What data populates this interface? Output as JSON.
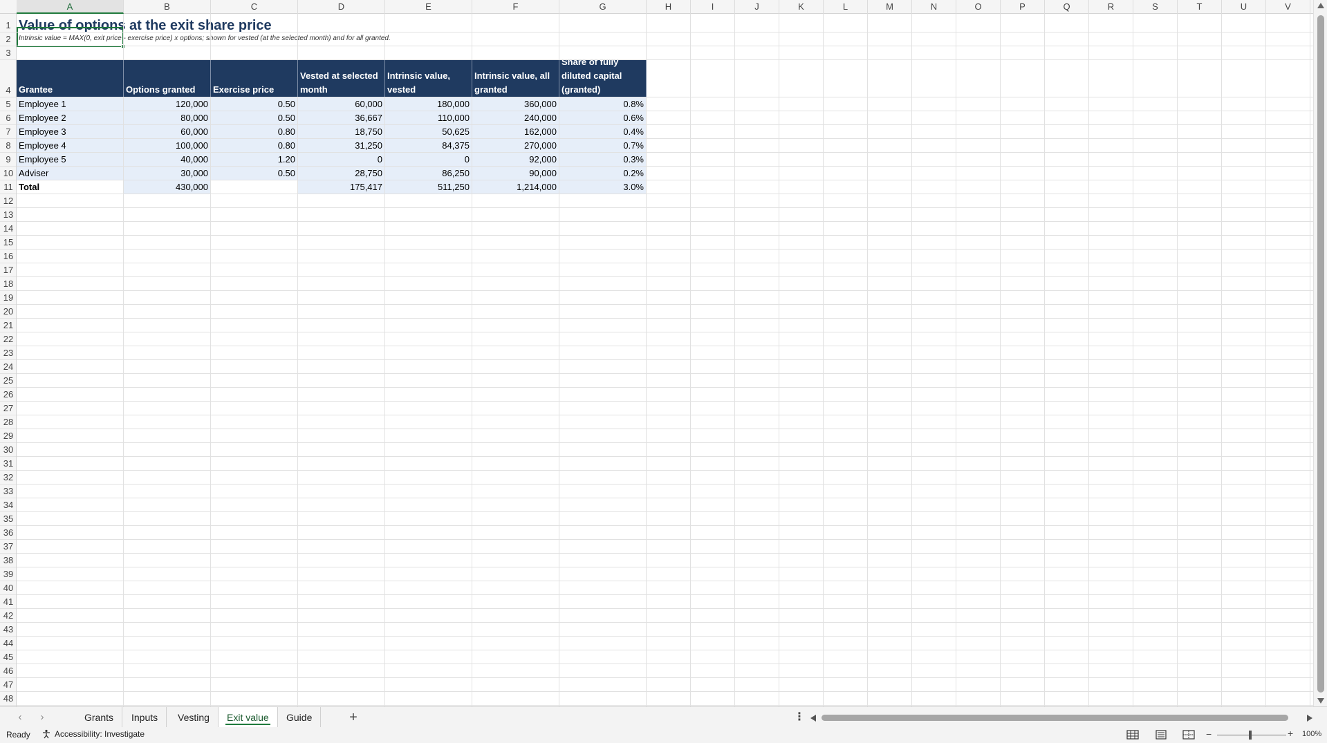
{
  "columns": [
    "A",
    "B",
    "C",
    "D",
    "E",
    "F",
    "G",
    "H",
    "I",
    "J",
    "K",
    "L",
    "M",
    "N",
    "O",
    "P",
    "Q",
    "R",
    "S",
    "T",
    "U",
    "V"
  ],
  "rows": [
    "1",
    "2",
    "3",
    "4",
    "5",
    "6",
    "7",
    "8",
    "9",
    "10",
    "11",
    "12",
    "13",
    "14",
    "15",
    "16",
    "17",
    "18",
    "19",
    "20",
    "21",
    "22",
    "23",
    "24",
    "25",
    "26",
    "27",
    "28",
    "29",
    "30",
    "31",
    "32",
    "33",
    "34",
    "35",
    "36",
    "37",
    "38",
    "39",
    "40",
    "41",
    "42",
    "43",
    "44",
    "45",
    "46",
    "47",
    "48"
  ],
  "sheet": {
    "title": "Value of options at the exit share price",
    "subtitle": "Intrinsic value = MAX(0, exit price - exercise price) x options; shown for vested (at the selected month) and for all granted.",
    "headers": [
      "Grantee",
      "Options granted",
      "Exercise price",
      "Vested at selected month",
      "Intrinsic value, vested",
      "Intrinsic value, all granted",
      "Share of fully diluted capital (granted)"
    ],
    "table_rows": [
      [
        "Employee 1",
        "120,000",
        "0.50",
        "60,000",
        "180,000",
        "360,000",
        "0.8%"
      ],
      [
        "Employee 2",
        "80,000",
        "0.50",
        "36,667",
        "110,000",
        "240,000",
        "0.6%"
      ],
      [
        "Employee 3",
        "60,000",
        "0.80",
        "18,750",
        "50,625",
        "162,000",
        "0.4%"
      ],
      [
        "Employee 4",
        "100,000",
        "0.80",
        "31,250",
        "84,375",
        "270,000",
        "0.7%"
      ],
      [
        "Employee 5",
        "40,000",
        "1.20",
        "0",
        "0",
        "92,000",
        "0.3%"
      ],
      [
        "Adviser",
        "30,000",
        "0.50",
        "28,750",
        "86,250",
        "90,000",
        "0.2%"
      ]
    ],
    "total_row": [
      "Total",
      "430,000",
      "",
      "175,417",
      "511,250",
      "1,214,000",
      "3.0%"
    ]
  },
  "tabs": [
    {
      "label": "Grants",
      "active": false
    },
    {
      "label": "Inputs",
      "active": false
    },
    {
      "label": "Vesting",
      "active": false
    },
    {
      "label": "Exit value",
      "active": true
    },
    {
      "label": "Guide",
      "active": false
    }
  ],
  "tab_nav": {
    "prev_icon": "chevron-left-icon",
    "next_icon": "chevron-right-icon",
    "add_label": "+",
    "more_label": "⋮"
  },
  "status": {
    "ready": "Ready",
    "accessibility": "Accessibility: Investigate",
    "zoom": "100%"
  },
  "colors": {
    "header_fill": "#1f3a60",
    "band_fill": "#e6eef9",
    "title_color": "#1f3a60",
    "selection": "#1f7a3c"
  },
  "selected_cell": "A1"
}
